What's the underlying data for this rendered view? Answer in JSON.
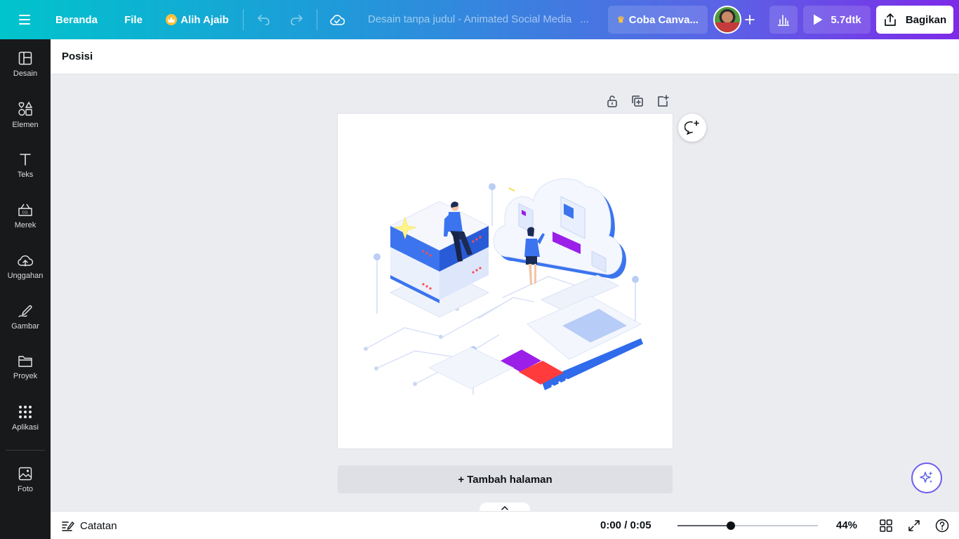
{
  "topbar": {
    "menu_icon": "hamburger-menu-icon",
    "home_label": "Beranda",
    "file_label": "File",
    "magic_resize_label": "Alih Ajaib",
    "doc_title": "Desain tanpa judul - Animated Social Media",
    "doc_title_ellipsis": "...",
    "try_canva_label": "Coba Canva...",
    "play_duration": "5.7dtk",
    "share_label": "Bagikan"
  },
  "sidebar": {
    "items": [
      {
        "label": "Desain",
        "icon": "layout-icon"
      },
      {
        "label": "Elemen",
        "icon": "shapes-icon"
      },
      {
        "label": "Teks",
        "icon": "text-icon"
      },
      {
        "label": "Merek",
        "icon": "brand-icon"
      },
      {
        "label": "Unggahan",
        "icon": "upload-cloud-icon"
      },
      {
        "label": "Gambar",
        "icon": "draw-icon"
      },
      {
        "label": "Proyek",
        "icon": "folder-icon"
      },
      {
        "label": "Aplikasi",
        "icon": "apps-grid-icon"
      },
      {
        "label": "Foto",
        "icon": "photo-icon"
      }
    ]
  },
  "contextbar": {
    "position_label": "Posisi"
  },
  "canvas": {
    "add_page_label": "+ Tambah halaman"
  },
  "bottombar": {
    "notes_label": "Catatan",
    "timecode": "0:00 / 0:05",
    "zoom_percent": "44%",
    "zoom_level": 0.38
  },
  "colors": {
    "sidebar_bg": "#18191b",
    "canvas_bg": "#ebecf0",
    "accent_purple": "#7d2ae8",
    "accent_teal": "#00c4cc",
    "illustration_blue": "#2f6bea",
    "illustration_magenta": "#9b1fe8",
    "illustration_red": "#ff3b3b"
  }
}
